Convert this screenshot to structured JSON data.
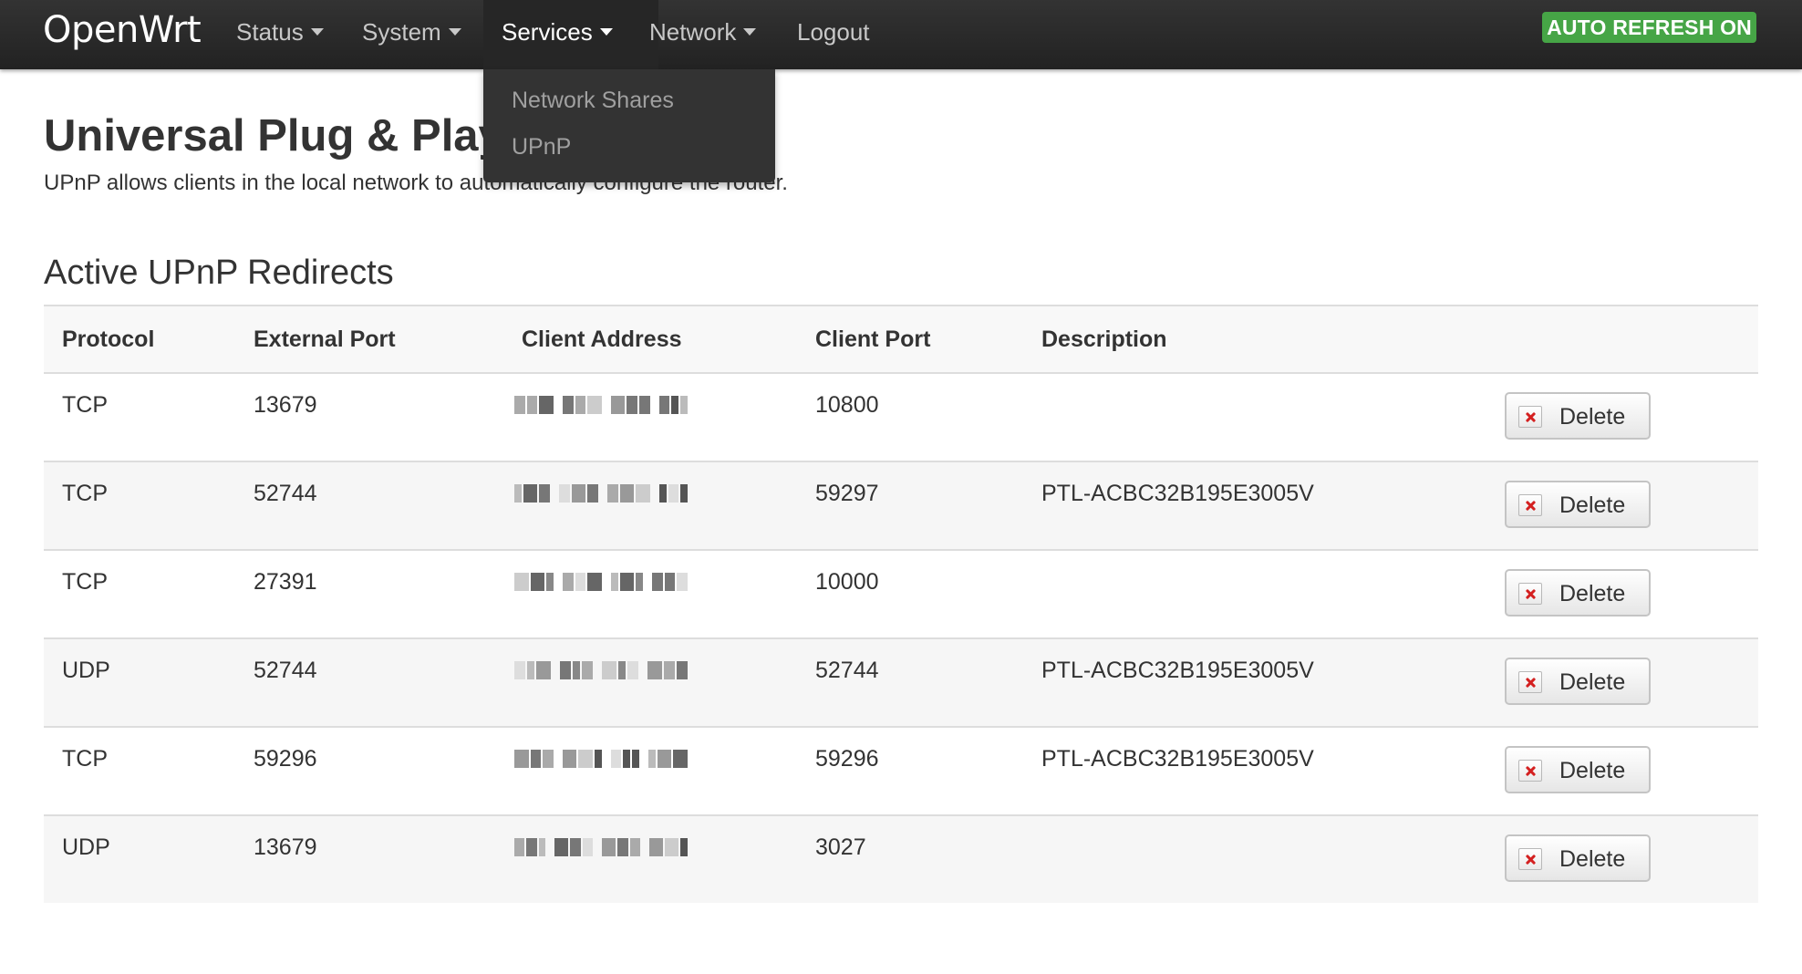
{
  "brand": "OpenWrt",
  "nav": {
    "items": [
      {
        "label": "Status",
        "has_caret": true
      },
      {
        "label": "System",
        "has_caret": true
      },
      {
        "label": "Services",
        "has_caret": true,
        "active": true
      },
      {
        "label": "Network",
        "has_caret": true
      },
      {
        "label": "Logout",
        "has_caret": false
      }
    ],
    "refresh_badge": "AUTO REFRESH ON"
  },
  "dropdown": {
    "items": [
      "Network Shares",
      "UPnP"
    ]
  },
  "page": {
    "title": "Universal Plug & Play",
    "description": "UPnP allows clients in the local network to automatically configure the router."
  },
  "redirects": {
    "section_title": "Active UPnP Redirects",
    "headers": [
      "Protocol",
      "External Port",
      "Client Address",
      "Client Port",
      "Description"
    ],
    "delete_label": "Delete",
    "client_address_note": "pixelated / redacted",
    "rows": [
      {
        "protocol": "TCP",
        "external_port": "13679",
        "client_port": "10800",
        "description": ""
      },
      {
        "protocol": "TCP",
        "external_port": "52744",
        "client_port": "59297",
        "description": "PTL-ACBC32B195E3005V"
      },
      {
        "protocol": "TCP",
        "external_port": "27391",
        "client_port": "10000",
        "description": ""
      },
      {
        "protocol": "UDP",
        "external_port": "52744",
        "client_port": "52744",
        "description": "PTL-ACBC32B195E3005V"
      },
      {
        "protocol": "TCP",
        "external_port": "59296",
        "client_port": "59296",
        "description": "PTL-ACBC32B195E3005V"
      },
      {
        "protocol": "UDP",
        "external_port": "13679",
        "client_port": "3027",
        "description": ""
      }
    ]
  },
  "colors": {
    "navbar": "#222222",
    "badge": "#46a546",
    "delete_icon": "#d42020"
  }
}
